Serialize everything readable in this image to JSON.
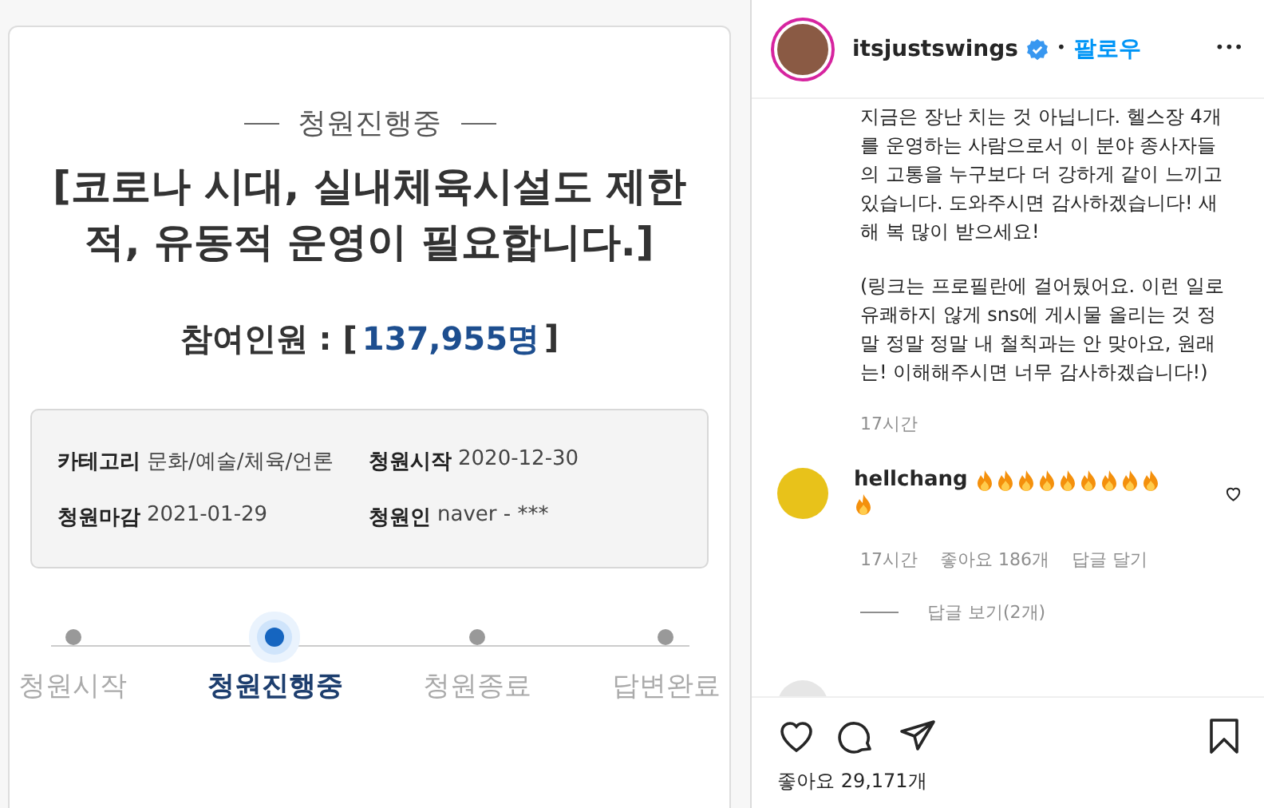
{
  "petition": {
    "status": "청원진행중",
    "title": "[코로나 시대, 실내체육시설도 제한적, 유동적 운영이 필요합니다.]",
    "participants_label": "참여인원 : [",
    "participants_count": "137,955명",
    "participants_close": "]",
    "info": [
      {
        "label": "카테고리",
        "value": "문화/예술/체육/언론"
      },
      {
        "label": "청원시작",
        "value": "2020-12-30"
      },
      {
        "label": "청원마감",
        "value": "2021-01-29"
      },
      {
        "label": "청원인",
        "value": "naver - ***"
      }
    ],
    "steps": [
      {
        "label": "청원시작",
        "selected": false
      },
      {
        "label": "청원진행중",
        "selected": true
      },
      {
        "label": "청원종료",
        "selected": false
      },
      {
        "label": "답변완료",
        "selected": false
      }
    ]
  },
  "post": {
    "username": "itsjustswings",
    "verified": true,
    "separator": "•",
    "follow": "팔로우",
    "more": "•••",
    "caption": [
      "지금은 장난 치는 것 아닙니다. 헬스장 4개를 운영하는 사람으로서 이 분야 종사자들의 고통을 누구보다 더 강하게 같이 느끼고 있습니다. 도와주시면 감사하겠습니다! 새해 복 많이 받으세요!",
      "(링크는 프로필란에 걸어뒀어요. 이런 일로 유쾌하지 않게 sns에 게시물 올리는 것 정말 정말 정말 내 철칙과는 안 맞아요, 원래는! 이해해주시면 너무 감사하겠습니다!)"
    ],
    "caption_time": "17시간",
    "comments": [
      {
        "username": "hellchang",
        "time": "17시간",
        "likes": "좋아요 186개",
        "reply": "답글 달기",
        "view_replies": "답글 보기(2개)"
      }
    ],
    "likes": "좋아요 29,171개"
  }
}
